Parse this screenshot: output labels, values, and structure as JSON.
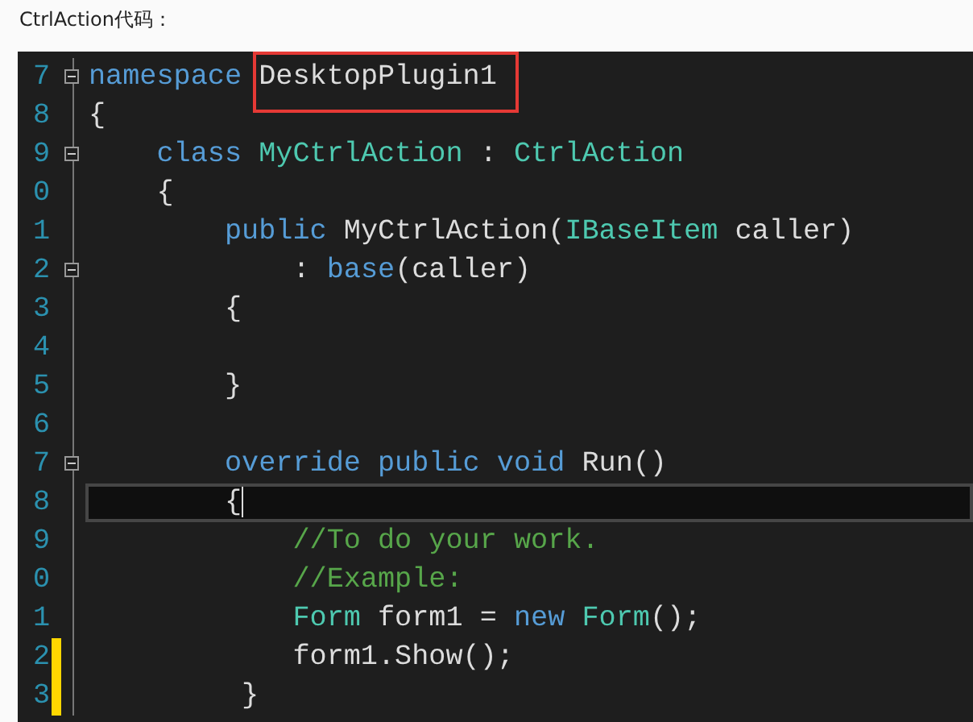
{
  "caption": "CtrlAction代码：",
  "editor": {
    "lines": [
      {
        "number": "7",
        "fold_start": true,
        "changed": false,
        "current": false,
        "tokens": [
          {
            "kind": "keyword",
            "text": "namespace"
          },
          {
            "kind": "plain",
            "text": " DesktopPlugin1",
            "highlighted": true
          }
        ]
      },
      {
        "number": "8",
        "fold_start": false,
        "changed": false,
        "current": false,
        "tokens": [
          {
            "kind": "plain",
            "text": "{"
          }
        ]
      },
      {
        "number": "9",
        "fold_start": true,
        "changed": false,
        "current": false,
        "tokens": [
          {
            "kind": "keyword",
            "text": "    class"
          },
          {
            "kind": "type",
            "text": " MyCtrlAction"
          },
          {
            "kind": "plain",
            "text": " : "
          },
          {
            "kind": "type",
            "text": "CtrlAction"
          }
        ]
      },
      {
        "number": "0",
        "fold_start": false,
        "changed": false,
        "current": false,
        "tokens": [
          {
            "kind": "plain",
            "text": "    {"
          }
        ]
      },
      {
        "number": "1",
        "fold_start": false,
        "changed": false,
        "current": false,
        "tokens": [
          {
            "kind": "keyword",
            "text": "        public"
          },
          {
            "kind": "plain",
            "text": " MyCtrlAction("
          },
          {
            "kind": "type",
            "text": "IBaseItem"
          },
          {
            "kind": "plain",
            "text": " caller)"
          }
        ]
      },
      {
        "number": "2",
        "fold_start": true,
        "changed": false,
        "current": false,
        "tokens": [
          {
            "kind": "plain",
            "text": "            : "
          },
          {
            "kind": "keyword",
            "text": "base"
          },
          {
            "kind": "plain",
            "text": "(caller)"
          }
        ]
      },
      {
        "number": "3",
        "fold_start": false,
        "changed": false,
        "current": false,
        "tokens": [
          {
            "kind": "plain",
            "text": "        {"
          }
        ]
      },
      {
        "number": "4",
        "fold_start": false,
        "changed": false,
        "current": false
      },
      {
        "number": "5",
        "fold_start": false,
        "changed": false,
        "current": false,
        "tokens": [
          {
            "kind": "plain",
            "text": "        }"
          }
        ]
      },
      {
        "number": "6",
        "fold_start": false,
        "changed": false,
        "current": false
      },
      {
        "number": "7",
        "fold_start": true,
        "changed": false,
        "current": false,
        "tokens": [
          {
            "kind": "keyword",
            "text": "        override public void"
          },
          {
            "kind": "plain",
            "text": " Run()"
          }
        ]
      },
      {
        "number": "8",
        "fold_start": false,
        "changed": false,
        "current": true,
        "tokens": [
          {
            "kind": "plain",
            "text": "        {"
          }
        ]
      },
      {
        "number": "9",
        "fold_start": false,
        "changed": false,
        "current": false,
        "tokens": [
          {
            "kind": "comment",
            "text": "            //To do your work."
          }
        ]
      },
      {
        "number": "0",
        "fold_start": false,
        "changed": false,
        "current": false,
        "tokens": [
          {
            "kind": "comment",
            "text": "            //Example:"
          }
        ]
      },
      {
        "number": "1",
        "fold_start": false,
        "changed": false,
        "current": false,
        "tokens": [
          {
            "kind": "type",
            "text": "            Form"
          },
          {
            "kind": "plain",
            "text": " form1 = "
          },
          {
            "kind": "keyword",
            "text": "new"
          },
          {
            "kind": "type",
            "text": " Form"
          },
          {
            "kind": "plain",
            "text": "();"
          }
        ]
      },
      {
        "number": "2",
        "fold_start": false,
        "changed": true,
        "current": false,
        "tokens": [
          {
            "kind": "plain",
            "text": "            form1.Show();"
          }
        ]
      },
      {
        "number": "3",
        "fold_start": false,
        "changed": true,
        "current": false,
        "tokens": [
          {
            "kind": "plain",
            "text": "         }"
          }
        ]
      }
    ]
  }
}
